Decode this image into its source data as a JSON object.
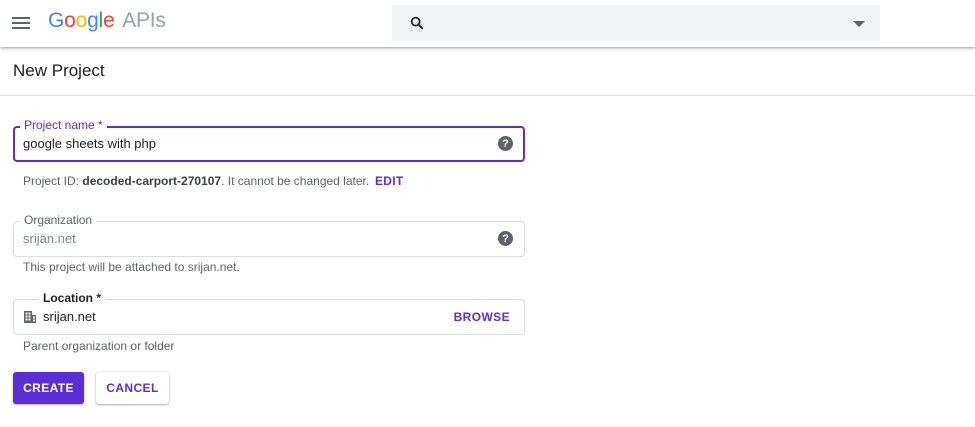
{
  "header": {
    "logo_parts": [
      "G",
      "o",
      "o",
      "g",
      "l",
      "e"
    ],
    "logo_suffix": "APIs",
    "search_placeholder": ""
  },
  "page": {
    "title": "New Project"
  },
  "project_name": {
    "label": "Project name *",
    "value": "google sheets with php",
    "help_icon": "?"
  },
  "project_id": {
    "prefix": "Project ID: ",
    "id": "decoded-carport-270107",
    "suffix": ". It cannot be changed later.",
    "edit_label": "EDIT"
  },
  "organization": {
    "label": "Organization",
    "value": "srijan.net",
    "help_icon": "?",
    "hint": "This project will be attached to srijan.net."
  },
  "location": {
    "label": "Location *",
    "value": "srijan.net",
    "browse_label": "BROWSE",
    "hint": "Parent organization or folder"
  },
  "actions": {
    "create_label": "CREATE",
    "cancel_label": "CANCEL"
  },
  "colors": {
    "accent": "#5b2fd6",
    "border": "#dadce0",
    "search_bg": "#f1f3f4"
  },
  "icons": [
    "menu-icon",
    "search-icon",
    "dropdown-caret-icon",
    "help-icon",
    "building-icon"
  ]
}
